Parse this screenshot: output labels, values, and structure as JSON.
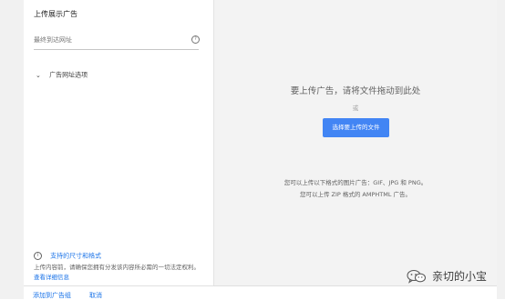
{
  "panel": {
    "title": "上传展示广告",
    "url_field": {
      "placeholder": "最终到达网址",
      "value": ""
    },
    "options_label": "广告网址选项",
    "supported_sizes_link": "支持的尺寸和格式",
    "disclaimer_text": "上传内容前，请确保您拥有分发该内容所必需的一切法定权利。",
    "disclaimer_link": "查看详细信息"
  },
  "dropzone": {
    "title": "要上传广告，请将文件拖动到此处",
    "or_text": "或",
    "choose_button": "选择要上传的文件",
    "format_line1": "您可以上传以下格式的图片广告：GIF、JPG 和 PNG。",
    "format_line2": "您可以上传 ZIP 格式的 AMPHTML 广告。"
  },
  "footer": {
    "add_button": "添加到广告组",
    "cancel_button": "取消"
  },
  "watermark": {
    "text": "亲切的小宝"
  },
  "icons": {
    "help": "help-circle-icon",
    "chevron": "chevron-down-icon",
    "info": "info-circle-icon",
    "wechat": "wechat-icon"
  },
  "colors": {
    "accent": "#4285f4",
    "link": "#1a73e8",
    "dropzone_bg": "#f3f3f3"
  }
}
